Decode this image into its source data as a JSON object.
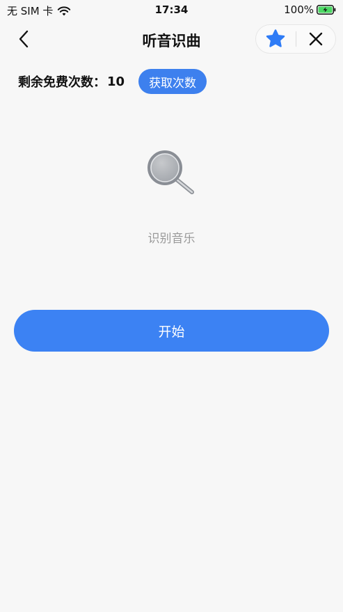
{
  "status_bar": {
    "carrier": "无 SIM 卡",
    "time": "17:34",
    "battery_percent": "100%"
  },
  "nav": {
    "title": "听音识曲",
    "back_icon": "chevron-left-icon",
    "star_icon": "star-icon",
    "close_icon": "close-icon"
  },
  "quota": {
    "label": "剩余免费次数：",
    "value": "10",
    "get_button": "获取次数"
  },
  "main": {
    "illustration_icon": "magnifier-icon",
    "hint": "识别音乐",
    "start_button": "开始"
  },
  "colors": {
    "accent": "#3c82f3",
    "background": "#f7f7f7",
    "hint_text": "#999999"
  }
}
